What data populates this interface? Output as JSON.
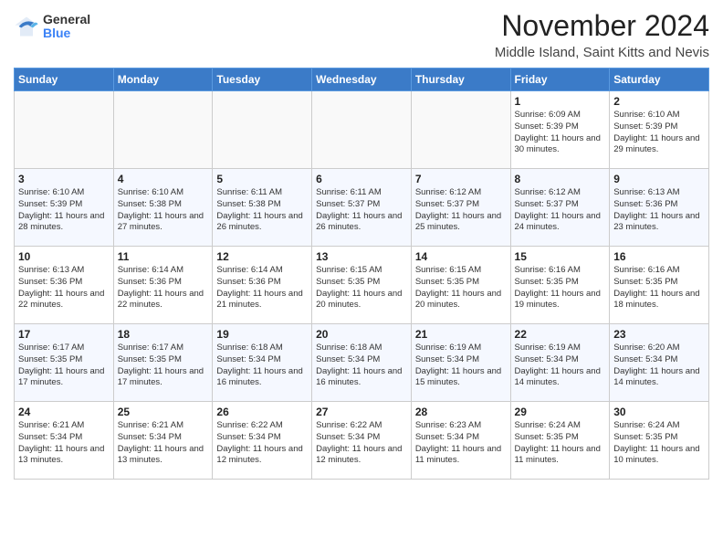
{
  "header": {
    "logo": {
      "general": "General",
      "blue": "Blue"
    },
    "title": "November 2024",
    "location": "Middle Island, Saint Kitts and Nevis"
  },
  "days_of_week": [
    "Sunday",
    "Monday",
    "Tuesday",
    "Wednesday",
    "Thursday",
    "Friday",
    "Saturday"
  ],
  "weeks": [
    [
      {
        "day": "",
        "info": ""
      },
      {
        "day": "",
        "info": ""
      },
      {
        "day": "",
        "info": ""
      },
      {
        "day": "",
        "info": ""
      },
      {
        "day": "",
        "info": ""
      },
      {
        "day": "1",
        "info": "Sunrise: 6:09 AM\nSunset: 5:39 PM\nDaylight: 11 hours and 30 minutes."
      },
      {
        "day": "2",
        "info": "Sunrise: 6:10 AM\nSunset: 5:39 PM\nDaylight: 11 hours and 29 minutes."
      }
    ],
    [
      {
        "day": "3",
        "info": "Sunrise: 6:10 AM\nSunset: 5:39 PM\nDaylight: 11 hours and 28 minutes."
      },
      {
        "day": "4",
        "info": "Sunrise: 6:10 AM\nSunset: 5:38 PM\nDaylight: 11 hours and 27 minutes."
      },
      {
        "day": "5",
        "info": "Sunrise: 6:11 AM\nSunset: 5:38 PM\nDaylight: 11 hours and 26 minutes."
      },
      {
        "day": "6",
        "info": "Sunrise: 6:11 AM\nSunset: 5:37 PM\nDaylight: 11 hours and 26 minutes."
      },
      {
        "day": "7",
        "info": "Sunrise: 6:12 AM\nSunset: 5:37 PM\nDaylight: 11 hours and 25 minutes."
      },
      {
        "day": "8",
        "info": "Sunrise: 6:12 AM\nSunset: 5:37 PM\nDaylight: 11 hours and 24 minutes."
      },
      {
        "day": "9",
        "info": "Sunrise: 6:13 AM\nSunset: 5:36 PM\nDaylight: 11 hours and 23 minutes."
      }
    ],
    [
      {
        "day": "10",
        "info": "Sunrise: 6:13 AM\nSunset: 5:36 PM\nDaylight: 11 hours and 22 minutes."
      },
      {
        "day": "11",
        "info": "Sunrise: 6:14 AM\nSunset: 5:36 PM\nDaylight: 11 hours and 22 minutes."
      },
      {
        "day": "12",
        "info": "Sunrise: 6:14 AM\nSunset: 5:36 PM\nDaylight: 11 hours and 21 minutes."
      },
      {
        "day": "13",
        "info": "Sunrise: 6:15 AM\nSunset: 5:35 PM\nDaylight: 11 hours and 20 minutes."
      },
      {
        "day": "14",
        "info": "Sunrise: 6:15 AM\nSunset: 5:35 PM\nDaylight: 11 hours and 20 minutes."
      },
      {
        "day": "15",
        "info": "Sunrise: 6:16 AM\nSunset: 5:35 PM\nDaylight: 11 hours and 19 minutes."
      },
      {
        "day": "16",
        "info": "Sunrise: 6:16 AM\nSunset: 5:35 PM\nDaylight: 11 hours and 18 minutes."
      }
    ],
    [
      {
        "day": "17",
        "info": "Sunrise: 6:17 AM\nSunset: 5:35 PM\nDaylight: 11 hours and 17 minutes."
      },
      {
        "day": "18",
        "info": "Sunrise: 6:17 AM\nSunset: 5:35 PM\nDaylight: 11 hours and 17 minutes."
      },
      {
        "day": "19",
        "info": "Sunrise: 6:18 AM\nSunset: 5:34 PM\nDaylight: 11 hours and 16 minutes."
      },
      {
        "day": "20",
        "info": "Sunrise: 6:18 AM\nSunset: 5:34 PM\nDaylight: 11 hours and 16 minutes."
      },
      {
        "day": "21",
        "info": "Sunrise: 6:19 AM\nSunset: 5:34 PM\nDaylight: 11 hours and 15 minutes."
      },
      {
        "day": "22",
        "info": "Sunrise: 6:19 AM\nSunset: 5:34 PM\nDaylight: 11 hours and 14 minutes."
      },
      {
        "day": "23",
        "info": "Sunrise: 6:20 AM\nSunset: 5:34 PM\nDaylight: 11 hours and 14 minutes."
      }
    ],
    [
      {
        "day": "24",
        "info": "Sunrise: 6:21 AM\nSunset: 5:34 PM\nDaylight: 11 hours and 13 minutes."
      },
      {
        "day": "25",
        "info": "Sunrise: 6:21 AM\nSunset: 5:34 PM\nDaylight: 11 hours and 13 minutes."
      },
      {
        "day": "26",
        "info": "Sunrise: 6:22 AM\nSunset: 5:34 PM\nDaylight: 11 hours and 12 minutes."
      },
      {
        "day": "27",
        "info": "Sunrise: 6:22 AM\nSunset: 5:34 PM\nDaylight: 11 hours and 12 minutes."
      },
      {
        "day": "28",
        "info": "Sunrise: 6:23 AM\nSunset: 5:34 PM\nDaylight: 11 hours and 11 minutes."
      },
      {
        "day": "29",
        "info": "Sunrise: 6:24 AM\nSunset: 5:35 PM\nDaylight: 11 hours and 11 minutes."
      },
      {
        "day": "30",
        "info": "Sunrise: 6:24 AM\nSunset: 5:35 PM\nDaylight: 11 hours and 10 minutes."
      }
    ]
  ]
}
